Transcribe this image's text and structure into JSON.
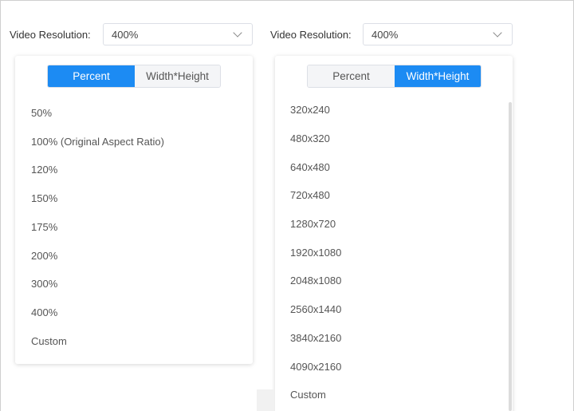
{
  "left": {
    "label": "Video Resolution:",
    "value": "400%",
    "tabs": [
      "Percent",
      "Width*Height"
    ],
    "active_tab": "Percent",
    "options": [
      "50%",
      "100% (Original Aspect Ratio)",
      "120%",
      "150%",
      "175%",
      "200%",
      "300%",
      "400%",
      "Custom"
    ]
  },
  "right": {
    "label": "Video Resolution:",
    "value": "400%",
    "tabs": [
      "Percent",
      "Width*Height"
    ],
    "active_tab": "Width*Height",
    "options": [
      "320x240",
      "480x320",
      "640x480",
      "720x480",
      "1280x720",
      "1920x1080",
      "2048x1080",
      "2560x1440",
      "3840x2160",
      "4090x2160",
      "Custom"
    ]
  },
  "colors": {
    "accent": "#1c8bf3",
    "tab_inactive_bg": "#f4f5f7",
    "text": "#555555"
  },
  "icons": {
    "select_arrow": "chevron-down-icon"
  }
}
